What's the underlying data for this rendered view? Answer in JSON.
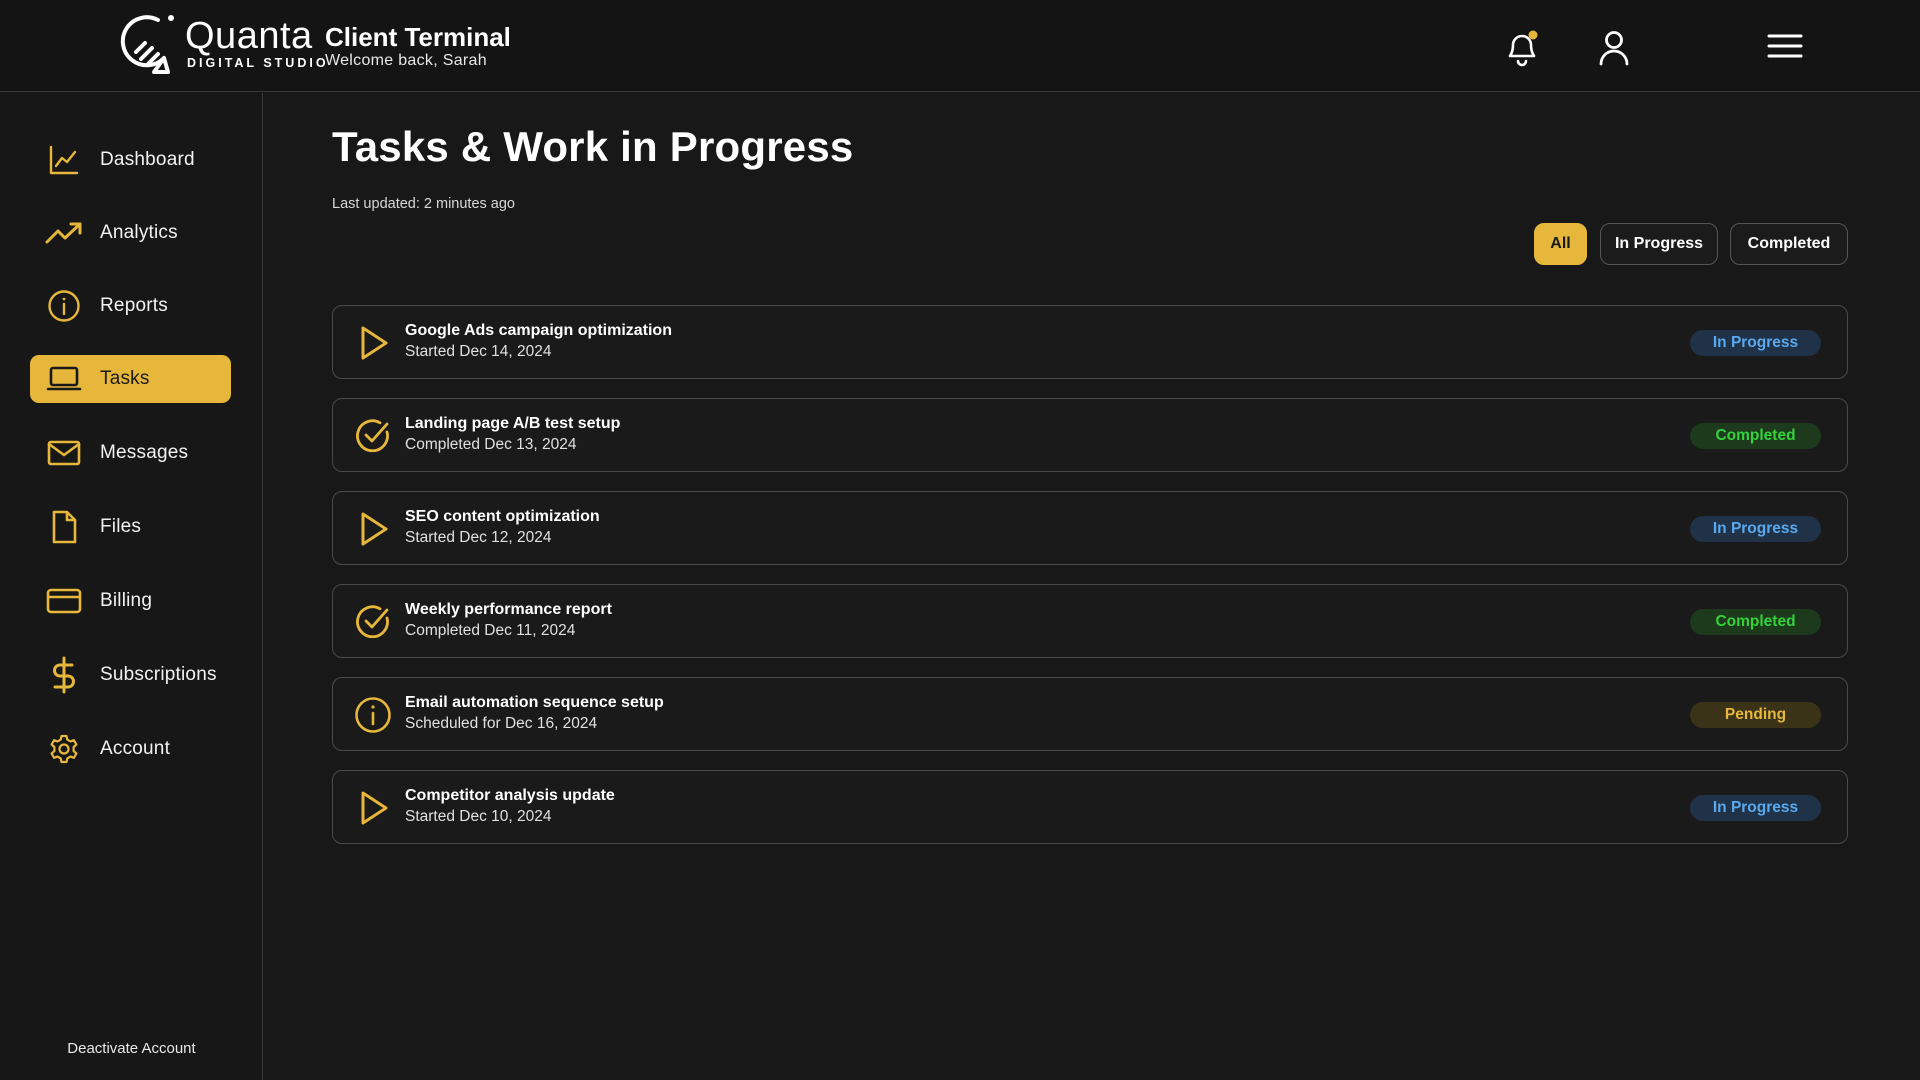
{
  "brand": {
    "name": "Quanta",
    "tagline": "DIGITAL STUDIO",
    "accent": "#e7b73b"
  },
  "header": {
    "title": "Client Terminal",
    "subtitle": "Welcome back, Sarah",
    "icons": [
      "bell-icon",
      "user-icon",
      "hamburger-menu-icon"
    ]
  },
  "sidebar": {
    "items": [
      {
        "label": "Dashboard",
        "icon": "line-chart-icon"
      },
      {
        "label": "Analytics",
        "icon": "trending-up-icon"
      },
      {
        "label": "Reports",
        "icon": "info-circle-icon"
      },
      {
        "label": "Tasks",
        "icon": "laptop-icon",
        "active": true
      },
      {
        "label": "Messages",
        "icon": "mail-icon"
      },
      {
        "label": "Files",
        "icon": "file-icon"
      },
      {
        "label": "Billing",
        "icon": "credit-card-icon"
      },
      {
        "label": "Subscriptions",
        "icon": "dollar-icon"
      },
      {
        "label": "Account",
        "icon": "gear-icon"
      }
    ],
    "footer": "Deactivate Account"
  },
  "main": {
    "title": "Tasks & Work in Progress",
    "updated": "Last updated: 2 minutes ago",
    "filters": [
      {
        "label": "All",
        "active": true
      },
      {
        "label": "In Progress"
      },
      {
        "label": "Completed"
      }
    ],
    "tasks": [
      {
        "name": "Google Ads campaign optimization",
        "date": "Started Dec 14, 2024",
        "status": "In Progress",
        "icon": "play-icon"
      },
      {
        "name": "Landing page A/B test setup",
        "date": "Completed Dec 13, 2024",
        "status": "Completed",
        "icon": "check-circle-icon"
      },
      {
        "name": "SEO content optimization",
        "date": "Started Dec 12, 2024",
        "status": "In Progress",
        "icon": "play-icon"
      },
      {
        "name": "Weekly performance report",
        "date": "Completed Dec 11, 2024",
        "status": "Completed",
        "icon": "check-circle-icon"
      },
      {
        "name": "Email automation sequence setup",
        "date": "Scheduled for Dec 16, 2024",
        "status": "Pending",
        "icon": "info-circle-icon"
      },
      {
        "name": "Competitor analysis update",
        "date": "Started Dec 10, 2024",
        "status": "In Progress",
        "icon": "play-icon"
      }
    ],
    "status_colors": {
      "In Progress": "#5aa9ee",
      "Completed": "#34d23b",
      "Pending": "#e7b73b"
    }
  }
}
